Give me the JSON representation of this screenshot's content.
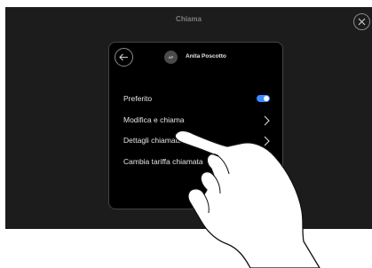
{
  "screen": {
    "title": "Chiama",
    "close_icon": "close-icon"
  },
  "panel": {
    "back_icon": "arrow-left-icon",
    "avatar_initials": "AP",
    "contact_name": "Anita Poscotto",
    "rows": [
      {
        "label": "Preferito",
        "control": "toggle",
        "toggle_on": true
      },
      {
        "label": "Modifica e chiama",
        "control": "chevron-right-icon"
      },
      {
        "label": "Dettagli chiamata",
        "control": "chevron-right-icon"
      },
      {
        "label": "Cambia tariffa chiamata",
        "control": "chevron-right-icon"
      }
    ]
  },
  "colors": {
    "screen_bg": "#1c1c1c",
    "panel_bg": "#000000",
    "accent": "#3d8bff"
  }
}
